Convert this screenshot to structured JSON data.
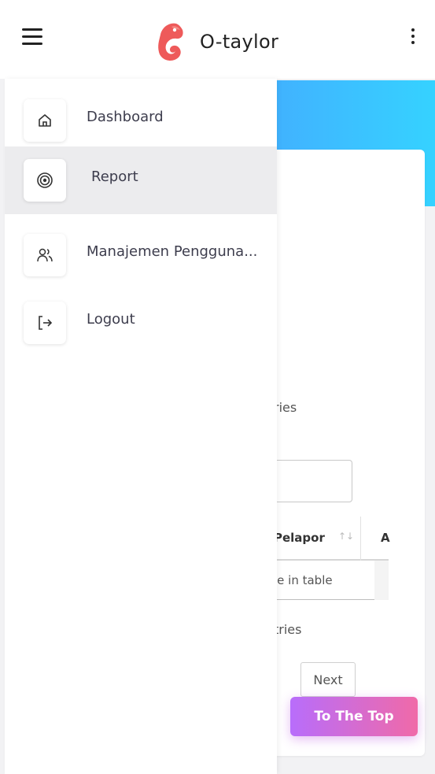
{
  "header": {
    "app_name": "O-taylor",
    "menu_icon": "hamburger-menu-icon",
    "logo_icon": "chameleon-logo",
    "more_icon": "kebab-menu-icon",
    "logo_color": "#ee5a5a"
  },
  "drawer": {
    "items": [
      {
        "label": "Dashboard",
        "icon": "home-icon",
        "active": false
      },
      {
        "label": "Report",
        "icon": "target-icon",
        "active": true
      },
      {
        "label": "Manajemen Pengguna...",
        "icon": "users-icon",
        "active": false
      },
      {
        "label": "Logout",
        "icon": "logout-icon",
        "active": false
      }
    ]
  },
  "background": {
    "entries_top_fragment": "ries",
    "table": {
      "col_pelapor": "Pelapor",
      "col_a": "A",
      "empty_fragment": "le in table"
    },
    "entries_bottom_fragment": "tries",
    "next_label": "Next"
  },
  "floating": {
    "to_top_label": "To The Top"
  },
  "colors": {
    "hero_gradient_start": "#4e7ff7",
    "hero_gradient_end": "#35d2ff",
    "to_top_start": "#b86dfb",
    "to_top_end": "#f06aa8",
    "active_item_bg": "#ececee"
  }
}
